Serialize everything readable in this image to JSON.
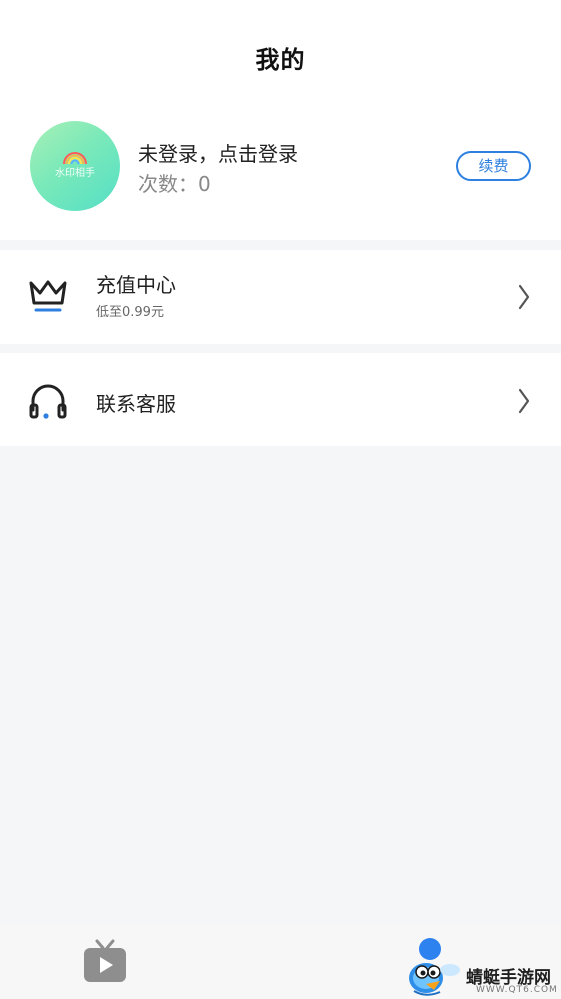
{
  "header": {
    "title": "我的"
  },
  "profile": {
    "avatar_text": "水印相手",
    "login_text": "未登录，点击登录",
    "count_label": "次数：",
    "count_value": "0",
    "renew_label": "续费"
  },
  "menu": {
    "recharge": {
      "icon": "crown-icon",
      "title": "充值中心",
      "subtitle": "低至0.99元"
    },
    "service": {
      "icon": "headset-icon",
      "title": "联系客服"
    }
  },
  "bottom_nav": {
    "items": [
      {
        "icon": "tv-play-icon",
        "active": false
      },
      {
        "icon": "profile-icon",
        "active": true
      }
    ]
  },
  "watermark": {
    "text": "蜻蜓手游网",
    "url": "WWW.QT6.COM"
  },
  "colors": {
    "accent": "#2d7fe0",
    "background": "#f5f6f8",
    "card": "#ffffff",
    "crown_underline": "#2d7fe0",
    "avatar_gradient_start": "#a8f0b6",
    "avatar_gradient_end": "#54dfc6"
  }
}
